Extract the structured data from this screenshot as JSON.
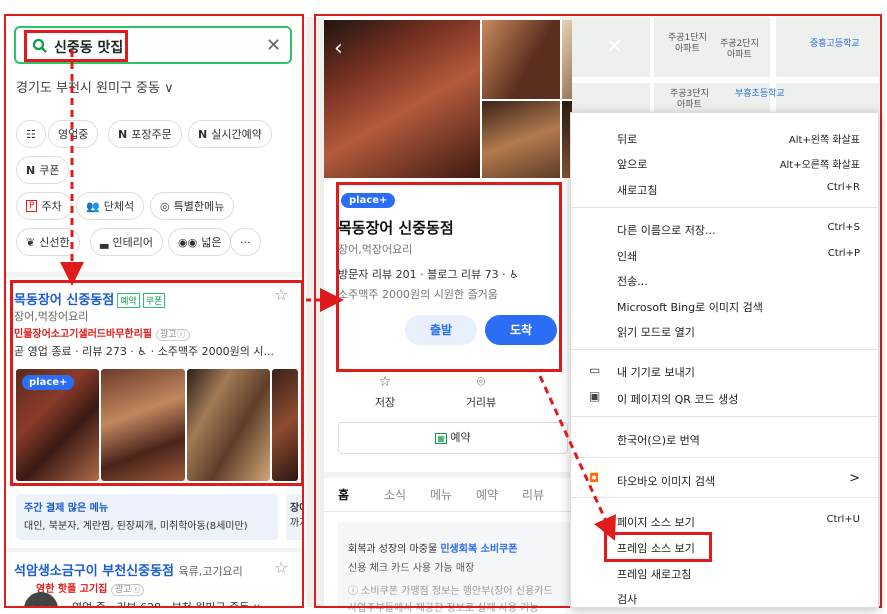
{
  "left": {
    "search_value": "신중동 맛집",
    "region": "경기도 부천시 원미구 중동",
    "chips": [
      {
        "label": "",
        "icon": "filter-icon"
      },
      {
        "label": "영업중",
        "icon": ""
      },
      {
        "label": "포장주문",
        "icon": "N"
      },
      {
        "label": "실시간예약",
        "icon": "N"
      },
      {
        "label": "쿠폰",
        "icon": "N"
      },
      {
        "label": "주차",
        "icon": "P"
      },
      {
        "label": "단체석",
        "icon": "group-icon"
      },
      {
        "label": "특별한메뉴",
        "icon": "dish-icon"
      },
      {
        "label": "신선한",
        "icon": "leaf-icon"
      },
      {
        "label": "인테리어",
        "icon": "sofa-icon"
      },
      {
        "label": "넓은",
        "icon": "eyes-icon"
      },
      {
        "label": "···",
        "icon": ""
      }
    ],
    "result1": {
      "title": "목동장어 신중동점",
      "badge_reserve": "예약",
      "badge_coupon": "쿠폰",
      "category": "장어,먹장어요리",
      "ad_text": "민물장어소고기샐러드바무한리필",
      "ad_tag": "광고ⓘ",
      "status": "곧 영업 종료 · 리뷰 273 · ♿ · 소주맥주 2000원의 시...",
      "place_plus": "place+",
      "menu_title": "주간 결제 많은 메뉴",
      "menu_items": "대인, 북분자, 계란찜, 된장찌개, 미취학아동(8세미만)",
      "menu2_title": "장어",
      "menu2_items": "까지"
    },
    "result2": {
      "title": "석암생소금구이 부천신중동점",
      "category": "육류,고기요리",
      "sub": "영한 핫플 고기집",
      "ad_tag": "광고ⓘ",
      "status": "영업 중 · 리뷰 628 · 부천 원미구 중동 ∨"
    }
  },
  "map_labels": [
    {
      "text": "주공1단지\n아파트",
      "blue": false
    },
    {
      "text": "주공2단지\n아파트",
      "blue": false
    },
    {
      "text": "중흥고등학교",
      "blue": true
    },
    {
      "text": "주공3단지\n아파트",
      "blue": false
    },
    {
      "text": "부흥초등학교",
      "blue": true
    }
  ],
  "detail": {
    "place_plus": "place+",
    "title": "목동장어 신중동점",
    "category": "장어,먹장어요리",
    "reviews": "방문자 리뷰 201 · 블로그 리뷰 73 · ♿",
    "desc": "소주맥주 2000원의 시원한 즐거움",
    "btn_start": "출발",
    "btn_go": "도착",
    "actions": [
      {
        "label": "저장",
        "icon": "star-icon"
      },
      {
        "label": "거리뷰",
        "icon": "pin-icon"
      }
    ],
    "reserve": "예약",
    "tabs": [
      "홈",
      "소식",
      "메뉴",
      "예약",
      "리뷰"
    ],
    "coupon_line1_pre": "회복과 성장의 마중물 ",
    "coupon_line1_brand": "민생회복 소비쿠폰",
    "coupon_line2": "신용 체크 카드 사용 가능 매장",
    "coupon_line3": "ⓘ 소비쿠폰 가맹점 정보는 행안부(장어 신용카드",
    "coupon_line4": "사업주부들에서 제공한 정보로 실제 사용 가능"
  },
  "context_menu": {
    "items": [
      {
        "label": "뒤로",
        "shortcut": "Alt+왼쪽 화살표",
        "icon": ""
      },
      {
        "label": "앞으로",
        "shortcut": "Alt+오른쪽 화살표",
        "icon": ""
      },
      {
        "label": "새로고침",
        "shortcut": "Ctrl+R",
        "icon": ""
      },
      {
        "label": "다른 이름으로 저장...",
        "shortcut": "Ctrl+S",
        "icon": ""
      },
      {
        "label": "인쇄",
        "shortcut": "Ctrl+P",
        "icon": ""
      },
      {
        "label": "전송...",
        "shortcut": "",
        "icon": ""
      },
      {
        "label": "Microsoft Bing로 이미지 검색",
        "shortcut": "",
        "icon": ""
      },
      {
        "label": "읽기 모드로 열기",
        "shortcut": "",
        "icon": ""
      },
      {
        "label": "내 기기로 보내기",
        "shortcut": "",
        "icon": "device-icon"
      },
      {
        "label": "이 페이지의 QR 코드 생성",
        "shortcut": "",
        "icon": "qr-icon"
      },
      {
        "label": "한국어(으)로 번역",
        "shortcut": "",
        "icon": ""
      },
      {
        "label": "타오바오 이미지 검색",
        "shortcut": ">",
        "icon": "taobao-icon"
      },
      {
        "label": "페이지 소스 보기",
        "shortcut": "Ctrl+U",
        "icon": ""
      },
      {
        "label": "프레임 소스 보기",
        "shortcut": "",
        "icon": ""
      },
      {
        "label": "프레임 새로고침",
        "shortcut": "",
        "icon": ""
      },
      {
        "label": "검사",
        "shortcut": "",
        "icon": ""
      }
    ]
  },
  "colors": {
    "highlight": "#e01b1b",
    "brand_green": "#2ec26b",
    "link_blue": "#1a5bd6",
    "primary": "#2b6ef5"
  }
}
